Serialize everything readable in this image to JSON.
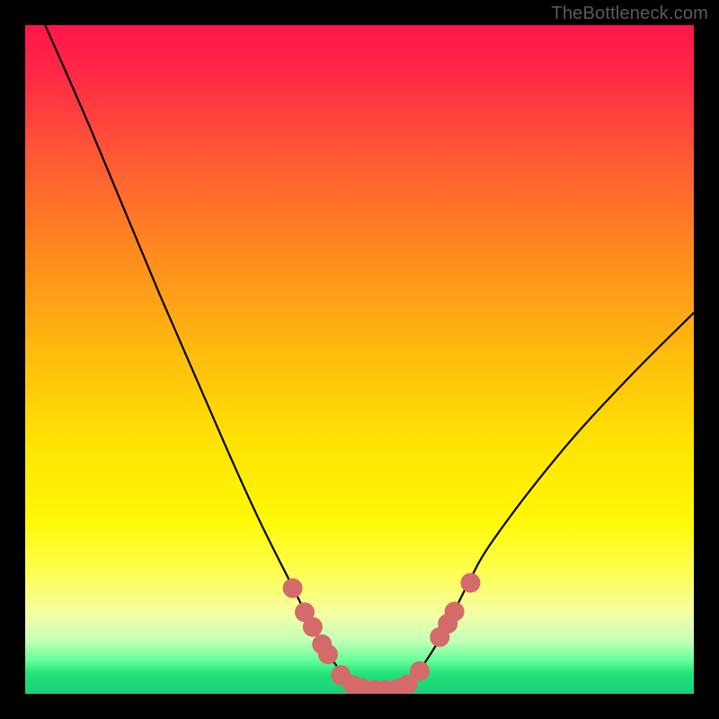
{
  "watermark": "TheBottleneck.com",
  "colors": {
    "frame": "#000000",
    "curve": "#000000",
    "marker_fill": "#d46a6a",
    "marker_stroke": "#c45858"
  },
  "chart_data": {
    "type": "line",
    "title": "",
    "xlabel": "",
    "ylabel": "",
    "xlim": [
      0,
      100
    ],
    "ylim": [
      0,
      100
    ],
    "series": [
      {
        "name": "bottleneck-curve",
        "x": [
          3,
          10,
          20,
          30,
          35,
          40,
          43,
          46,
          48,
          50,
          52,
          54,
          56,
          58,
          60,
          63,
          66,
          70,
          80,
          90,
          100
        ],
        "y": [
          100,
          84,
          60,
          37,
          26,
          16,
          10,
          5,
          2.5,
          1,
          0.5,
          0.5,
          1,
          2.5,
          5,
          10,
          16,
          23,
          36,
          47,
          57
        ]
      }
    ],
    "markers": [
      {
        "x": 40.0,
        "y": 15.8,
        "r": 1.2
      },
      {
        "x": 41.8,
        "y": 12.2,
        "r": 1.2
      },
      {
        "x": 43.0,
        "y": 10.0,
        "r": 1.2
      },
      {
        "x": 44.4,
        "y": 7.4,
        "r": 1.2
      },
      {
        "x": 45.3,
        "y": 5.9,
        "r": 1.2
      },
      {
        "x": 47.2,
        "y": 2.8,
        "r": 1.2
      },
      {
        "x": 49.0,
        "y": 1.3,
        "r": 1.2
      },
      {
        "x": 50.5,
        "y": 0.8,
        "r": 1.2
      },
      {
        "x": 52.2,
        "y": 0.6,
        "r": 1.2
      },
      {
        "x": 54.0,
        "y": 0.6,
        "r": 1.2
      },
      {
        "x": 55.8,
        "y": 0.8,
        "r": 1.2
      },
      {
        "x": 57.2,
        "y": 1.4,
        "r": 1.2
      },
      {
        "x": 59.0,
        "y": 3.4,
        "r": 1.2
      },
      {
        "x": 62.0,
        "y": 8.5,
        "r": 1.2
      },
      {
        "x": 63.2,
        "y": 10.5,
        "r": 1.2
      },
      {
        "x": 64.2,
        "y": 12.3,
        "r": 1.2
      },
      {
        "x": 66.6,
        "y": 16.6,
        "r": 1.2
      }
    ]
  }
}
